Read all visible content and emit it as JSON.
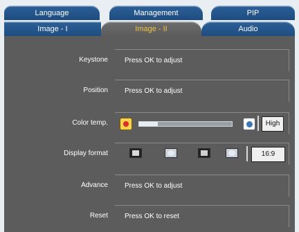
{
  "tabs": {
    "row1": [
      {
        "label": "Language"
      },
      {
        "label": "Management"
      },
      {
        "label": "PIP"
      }
    ],
    "row2": [
      {
        "label": "Image - I"
      },
      {
        "label": "Image - II",
        "active": true
      },
      {
        "label": "Audio"
      }
    ],
    "active_color": "#f0c33d"
  },
  "menu": {
    "keystone": {
      "label": "Keystone",
      "value": "Press OK  to adjust"
    },
    "position": {
      "label": "Position",
      "value": "Press OK  to adjust"
    },
    "color_temp": {
      "label": "Color temp.",
      "value": "High",
      "slider_level": 0.2,
      "icons": [
        "warm-color-icon",
        "cool-color-icon"
      ]
    },
    "display_format": {
      "label": "Display format",
      "value": "16:9",
      "icons": [
        "format-4-3-icon",
        "format-window-icon",
        "format-letterbox-icon",
        "format-wide-icon"
      ]
    },
    "advance": {
      "label": "Advance",
      "value": "Press OK  to adjust"
    },
    "reset": {
      "label": "Reset",
      "value": "Press OK  to reset"
    }
  }
}
